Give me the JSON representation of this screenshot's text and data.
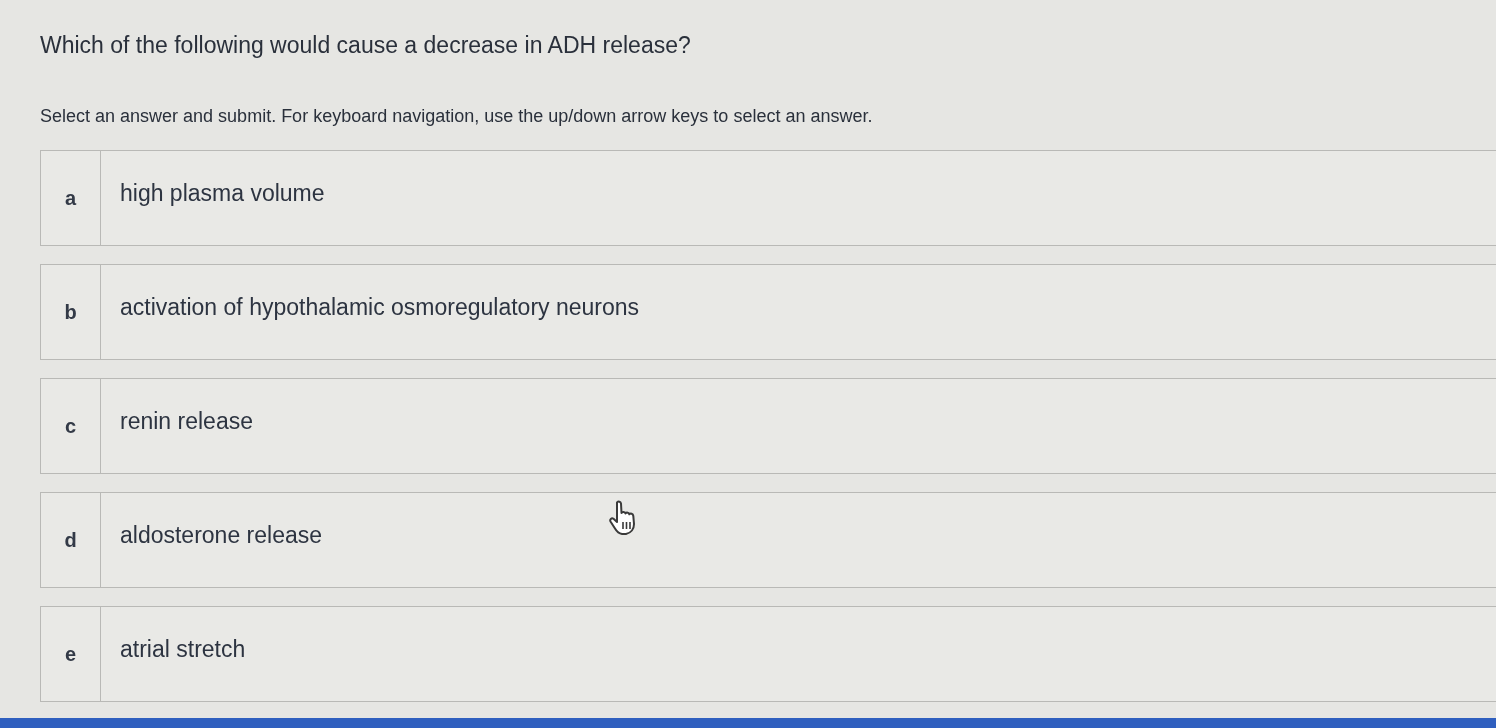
{
  "question": "Which of the following would cause a decrease in ADH release?",
  "instructions": "Select an answer and submit. For keyboard navigation, use the up/down arrow keys to select an answer.",
  "options": [
    {
      "letter": "a",
      "text": "high plasma volume",
      "selected": false
    },
    {
      "letter": "b",
      "text": "activation of hypothalamic osmoregulatory neurons",
      "selected": false
    },
    {
      "letter": "c",
      "text": "renin release",
      "selected": false
    },
    {
      "letter": "d",
      "text": "aldosterone release",
      "selected": false
    },
    {
      "letter": "e",
      "text": "atrial stretch",
      "selected": false
    }
  ]
}
